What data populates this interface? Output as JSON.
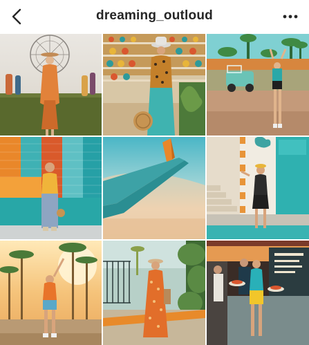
{
  "header": {
    "username": "dreaming_outloud",
    "back_icon": "chevron-left-icon",
    "more_icon": "more-horizontal-icon"
  },
  "grid": {
    "posts": [
      {
        "scene": "festival-ferris-wheel"
      },
      {
        "scene": "pottery-shop-leopard-top"
      },
      {
        "scene": "vintage-jeep-palms"
      },
      {
        "scene": "colorful-stripe-wall"
      },
      {
        "scene": "airplane-wing-sky"
      },
      {
        "scene": "teal-wall-stairs"
      },
      {
        "scene": "palm-trees-sunset"
      },
      {
        "scene": "orange-dress-path"
      },
      {
        "scene": "food-truck-yellow-shorts"
      }
    ]
  },
  "colors": {
    "accent_orange": "#e9872a",
    "accent_teal": "#2aa8a8"
  }
}
